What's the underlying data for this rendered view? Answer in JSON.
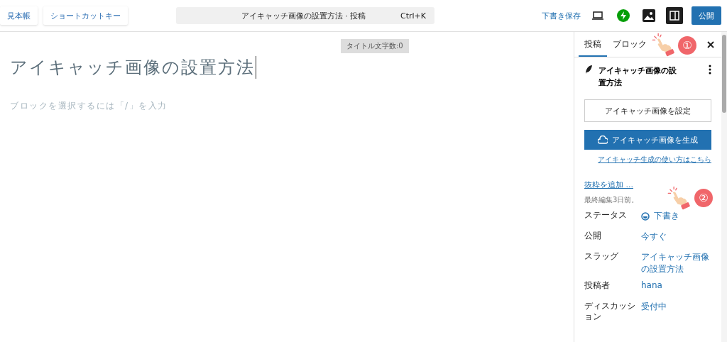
{
  "toolbar": {
    "left_buttons": [
      "見本帳",
      "ショートカットキー"
    ],
    "command": {
      "title": "アイキャッチ画像の設置方法 · 投稿",
      "shortcut": "Ctrl+K"
    },
    "save_draft": "下書き保存",
    "publish": "公開",
    "settings_open": true
  },
  "editor": {
    "title_count": "タイトル文字数:0",
    "title": "アイキャッチ画像の設置方法",
    "placeholder": "ブロックを選択するには「/」を入力"
  },
  "sidebar": {
    "tabs": [
      {
        "label": "投稿",
        "selected": true
      },
      {
        "label": "ブロック",
        "selected": false
      }
    ],
    "post_title": "アイキャッチ画像の設置方法",
    "set_featured": "アイキャッチ画像を設定",
    "generate": "アイキャッチ画像を生成",
    "help_link": "アイキャッチ生成の使い方はこちら",
    "excerpt_link": "抜粋を追加 ...",
    "last_edited": "最終編集3日前。",
    "fields": [
      {
        "label": "ステータス",
        "value": "下書き",
        "kind": "status"
      },
      {
        "label": "公開",
        "value": "今すぐ",
        "kind": "plain"
      },
      {
        "label": "スラッグ",
        "value": "アイキャッチ画像の設置方法",
        "kind": "plain"
      },
      {
        "label": "投稿者",
        "value": "hana",
        "kind": "plain"
      },
      {
        "label": "ディスカッション",
        "value": "受付中",
        "kind": "plain"
      }
    ]
  },
  "annotations": [
    {
      "number": "①"
    },
    {
      "number": "②"
    }
  ]
}
